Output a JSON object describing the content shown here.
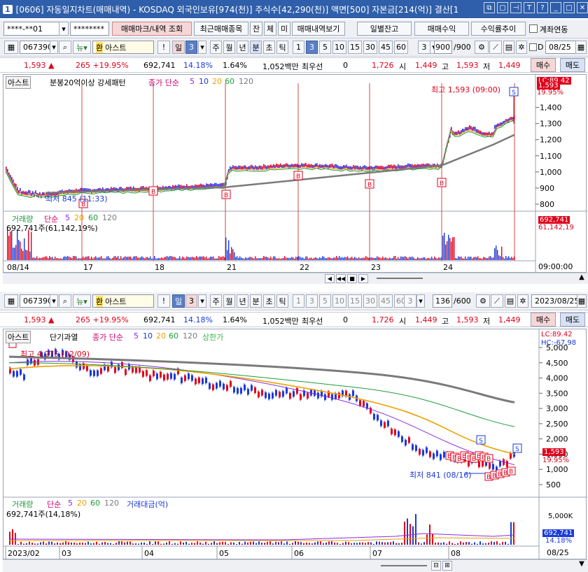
{
  "window": {
    "num": "1",
    "title": "[0606] 자동일지차트(매매내역) - KOSDAQ 외국인보유[974(천)] 주식수[42,290(천)] 액면[500] 자본금[214(억)] 결산[1"
  },
  "toolbar": {
    "account": "****-**01",
    "password": "********",
    "btn_trade_mark": "매매마크/내역 조회",
    "btn_recent": "최근매매종목",
    "btn_jan": "잔",
    "btn_che": "체",
    "btn_mi": "미",
    "btn_history": "매매내역보기",
    "btn_daily": "일별잔고",
    "btn_profit": "매매수익",
    "btn_return": "수익률추이",
    "chk_account": "계좌연동"
  },
  "upper": {
    "code": "067390",
    "name": "아스트",
    "period": "3",
    "buttons": [
      "주",
      "월",
      "년",
      "분",
      "초",
      "틱"
    ],
    "intervals": [
      "1",
      "3",
      "5",
      "10",
      "15",
      "30",
      "45",
      "60"
    ],
    "sel_interval": "3",
    "count": "900",
    "total": "/900",
    "date": "08/25",
    "quote": {
      "price": "1,593 ▲",
      "change": "265 +19.95%",
      "volume": "692,741",
      "turnover": "14.18%",
      "ratio": "1.64%",
      "amount": "1,052백만",
      "label_best": "최우선",
      "best": "0",
      "prev": "1,726",
      "lbl_open": "시",
      "open": "1,449",
      "lbl_high": "고",
      "high": "1,593",
      "lbl_low": "저",
      "low": "1,449",
      "buy": "매수",
      "sell": "매도"
    },
    "legend": {
      "name": "아스트",
      "pattern": "분봉20억이상 강세패턴",
      "ma_label": "종가 단순",
      "ma": [
        "5",
        "10",
        "20",
        "60",
        "120"
      ]
    },
    "high_label": "최고 1,593 (09:00)",
    "low_label": "최저 845 (11:33)",
    "price_tag": "1,593",
    "pct_tag": "19.95%",
    "lc": "LC:89.42",
    "y_ticks": [
      "1,400",
      "1,300",
      "1,200",
      "1,100",
      "1,000",
      "900",
      "800"
    ],
    "vol_legend": {
      "label": "거래량",
      "ma_label": "단순",
      "ma": [
        "5",
        "20",
        "60",
        "120"
      ],
      "value": "692,741주(61,142,19%)"
    },
    "vol_tag": "692,741",
    "vol_tag2": "61,142,19",
    "x_labels": [
      "08/14",
      "17",
      "18",
      "21",
      "22",
      "23",
      "24"
    ],
    "time": "09:00:00"
  },
  "lower": {
    "code": "067390",
    "name": "아스트",
    "period": "3",
    "buttons": [
      "주",
      "월",
      "년",
      "분",
      "초",
      "틱"
    ],
    "intervals": [
      "1",
      "3",
      "5",
      "10",
      "15",
      "30",
      "45",
      "60"
    ],
    "sel_interval": "3",
    "count": "136",
    "total": "/600",
    "date": "2023/08/25",
    "quote": {
      "price": "1,593 ▲",
      "change": "265 +19.95%",
      "volume": "692,741",
      "turnover": "14.18%",
      "ratio": "1.64%",
      "amount": "1,052백만",
      "label_best": "최우선",
      "best": "0",
      "prev": "1,726",
      "lbl_open": "시",
      "open": "1,449",
      "lbl_high": "고",
      "high": "1,593",
      "lbl_low": "저",
      "low": "1,449",
      "buy": "매수",
      "sell": "매도"
    },
    "legend": {
      "name": "아스트",
      "pattern": "단기과열",
      "ma_label": "종가 단순",
      "ma": [
        "5",
        "10",
        "20",
        "60",
        "120"
      ],
      "limit": "상한가"
    },
    "high_label": "최고 4,975 (02/09)",
    "low_label": "최저 841 (08/16)",
    "price_tag": "1,593",
    "pct_tag": "19.95%",
    "lc": "LC:89.42",
    "hc": "HC:-67.98",
    "y_ticks": [
      "5,000",
      "4,500",
      "4,000",
      "3,500",
      "3,000",
      "2,500",
      "2,000",
      "1,500",
      "1,000",
      "500"
    ],
    "vol_legend": {
      "label": "거래량",
      "ma_label": "단순",
      "ma": [
        "5",
        "20",
        "60",
        "120"
      ],
      "amt": "거래대금(억)",
      "value": "692,741주(14,18%)"
    },
    "vol_tick": "5,000K",
    "vol_tag": "692,741",
    "vol_tag2": "14.18%",
    "x_labels": [
      "2023/02",
      "03",
      "04",
      "05",
      "06",
      "07",
      "08"
    ],
    "date_label": "08/25"
  },
  "colors": {
    "up": "#e0001b",
    "down": "#1a3ad8",
    "ma5": "#8a2be2",
    "ma20": "#f0a000",
    "ma60": "#1f9a3a",
    "ma120": "#7a7a7a",
    "accent": "#2f5faa"
  }
}
